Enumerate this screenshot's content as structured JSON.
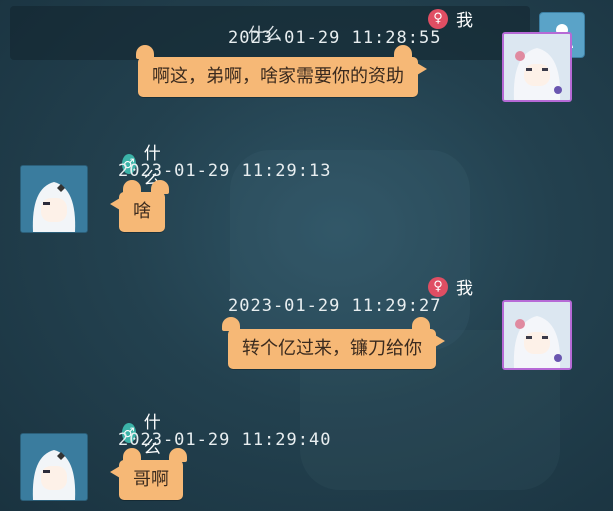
{
  "colors": {
    "bubble": "#f6b876",
    "female": "#e04e63",
    "male": "#3bb3a8",
    "self_frame": "#b66ad6",
    "background": "#23414f"
  },
  "messages": [
    {
      "side": "right",
      "sender": "我",
      "gender_icon": "female-icon",
      "gender_symbol": "♀",
      "timestamp": "2023-01-29 11:28:55",
      "text": "啊这，弟啊，啥家需要你的资助"
    },
    {
      "side": "left",
      "sender": "什么",
      "gender_icon": "male-icon",
      "gender_symbol": "♂",
      "timestamp": "2023-01-29 11:29:13",
      "text": "啥"
    },
    {
      "side": "right",
      "sender": "我",
      "gender_icon": "female-icon",
      "gender_symbol": "♀",
      "timestamp": "2023-01-29 11:29:27",
      "text": "转个亿过来，镰刀给你"
    },
    {
      "side": "left",
      "sender": "什么",
      "gender_icon": "male-icon",
      "gender_symbol": "♂",
      "timestamp": "2023-01-29 11:29:40",
      "text": "哥啊"
    }
  ],
  "header": {
    "faded_name": "什么",
    "profile_icon": "user-profile-icon"
  }
}
